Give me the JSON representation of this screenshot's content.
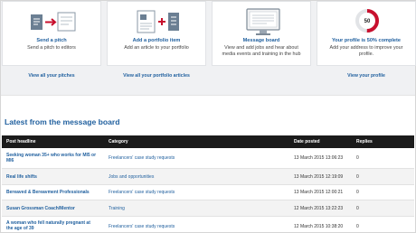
{
  "cards": [
    {
      "title": "Send a pitch",
      "description": "Send a pitch to editors",
      "link": "View all your pitches",
      "icon": "pitch-arrow-icon"
    },
    {
      "title": "Add a portfolio item",
      "description": "Add an article to your portfolio",
      "link": "View all your portfolio articles",
      "icon": "portfolio-add-icon"
    },
    {
      "title": "Message board",
      "description": "View and add jobs and hear about media events and training in the hub",
      "link": "",
      "icon": "monitor-icon"
    },
    {
      "title": "Your profile is 50% complete",
      "description": "Add your address to improve your profile.",
      "link": "View your profile",
      "icon": "profile-progress-icon",
      "progress_label": "50",
      "progress_fraction": 0.5
    }
  ],
  "colors": {
    "accent": "#1f5f9e",
    "brand_red": "#c8102e",
    "header_bg": "#1b1b1b"
  },
  "message_board": {
    "heading": "Latest from the message board",
    "columns": [
      "Post headline",
      "Category",
      "Date posted",
      "Replies"
    ],
    "rows": [
      {
        "headline": "Seeking woman 35+ who works for MI5 or MI6",
        "category": "Freelancers' case study requests",
        "date": "13 March 2015 13:06:23",
        "replies": "0"
      },
      {
        "headline": "Real life shifts",
        "category": "Jobs and opportunities",
        "date": "13 March 2015 12:19:09",
        "replies": "0"
      },
      {
        "headline": "Bereaved & Bereavment Professionals",
        "category": "Freelancers' case study requests",
        "date": "13 March 2015 12:00:21",
        "replies": "0"
      },
      {
        "headline": "Susan Grossman Coach/Mentor",
        "category": "Training",
        "date": "12 March 2015 13:22:23",
        "replies": "0"
      },
      {
        "headline": "A woman who fell naturally pregnant at the age of 39",
        "category": "Freelancers' case study requests",
        "date": "12 March 2015 10:38:20",
        "replies": "0"
      }
    ]
  }
}
